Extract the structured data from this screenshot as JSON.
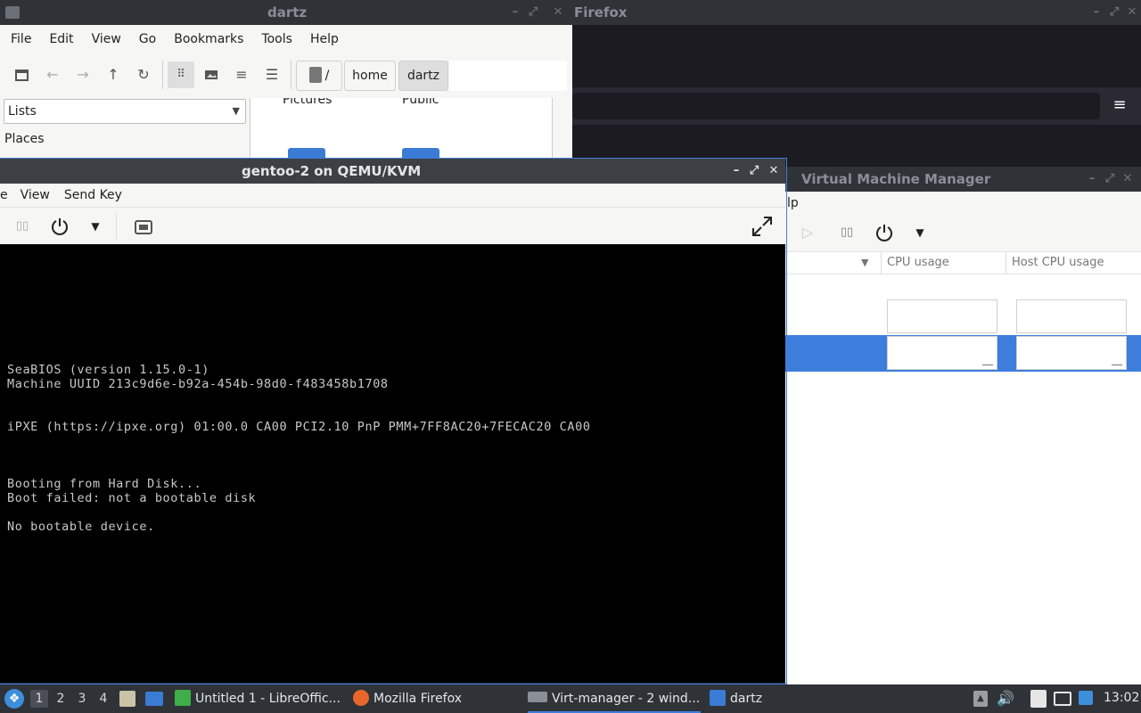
{
  "file_manager": {
    "title": "dartz",
    "menu": [
      "File",
      "Edit",
      "View",
      "Go",
      "Bookmarks",
      "Tools",
      "Help"
    ],
    "path": [
      "/",
      "home",
      "dartz"
    ],
    "side_select": "Lists",
    "places_label": "Places",
    "folders": [
      "Pictures",
      "Public"
    ]
  },
  "firefox": {
    "title": "Firefox"
  },
  "qemu": {
    "title": "gentoo-2 on QEMU/KVM",
    "menu": [
      "e",
      "View",
      "Send Key"
    ],
    "console_lines": [
      "SeaBIOS (version 1.15.0-1)",
      "Machine UUID 213c9d6e-b92a-454b-98d0-f483458b1708",
      "iPXE (https://ipxe.org) 01:00.0 CA00 PCI2.10 PnP PMM+7FF8AC20+7FECAC20 CA00",
      "Booting from Hard Disk...",
      "Boot failed: not a bootable disk",
      "No bootable device."
    ]
  },
  "vmm": {
    "title": "Virtual Machine Manager",
    "menu_partial": "lp",
    "columns": [
      "CPU usage",
      "Host CPU usage"
    ]
  },
  "taskbar": {
    "workspaces": [
      "1",
      "2",
      "3",
      "4"
    ],
    "tasks": [
      "Untitled 1 - LibreOffic...",
      "Mozilla Firefox",
      "Virt-manager - 2 wind...",
      "dartz"
    ],
    "clock": "13:02"
  },
  "colors": {
    "selection": "#3d7edc",
    "terminal_bg": "#000000",
    "panel_bg": "#2f3338"
  }
}
